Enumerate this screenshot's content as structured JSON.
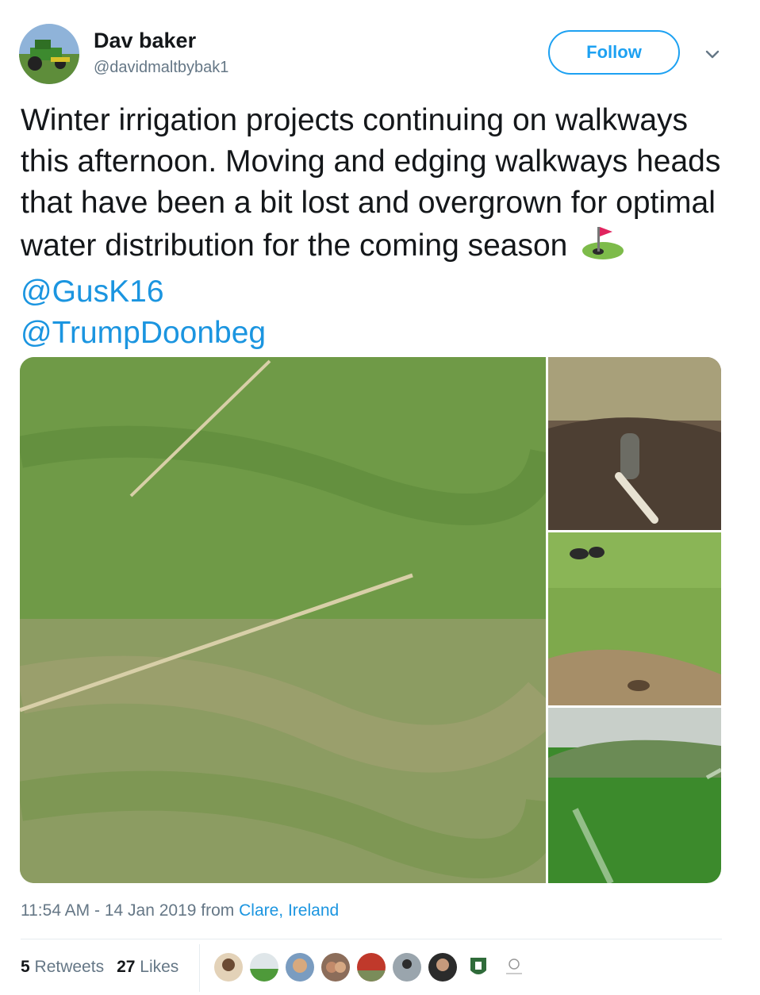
{
  "user": {
    "display_name": "Dav baker",
    "handle": "@davidmaltbybak1",
    "follow_label": "Follow"
  },
  "tweet": {
    "text_main": "Winter irrigation projects continuing on walkways this afternoon. Moving and edging walkways heads that have been a bit lost and overgrown for optimal water distribution for the coming season",
    "emoji": "flag-in-hole",
    "mention1": "@GusK16",
    "mention2": "@TrumpDoonbeg"
  },
  "meta": {
    "time": "11:54 AM - 14 Jan 2019 from ",
    "location": "Clare, Ireland"
  },
  "stats": {
    "retweets_count": "5",
    "retweets_label": "Retweets",
    "likes_count": "27",
    "likes_label": "Likes"
  },
  "colors": {
    "accent": "#1da1f2",
    "link": "#1b95e0",
    "secondary_text": "#657786"
  },
  "media": {
    "photo_count": 4
  }
}
